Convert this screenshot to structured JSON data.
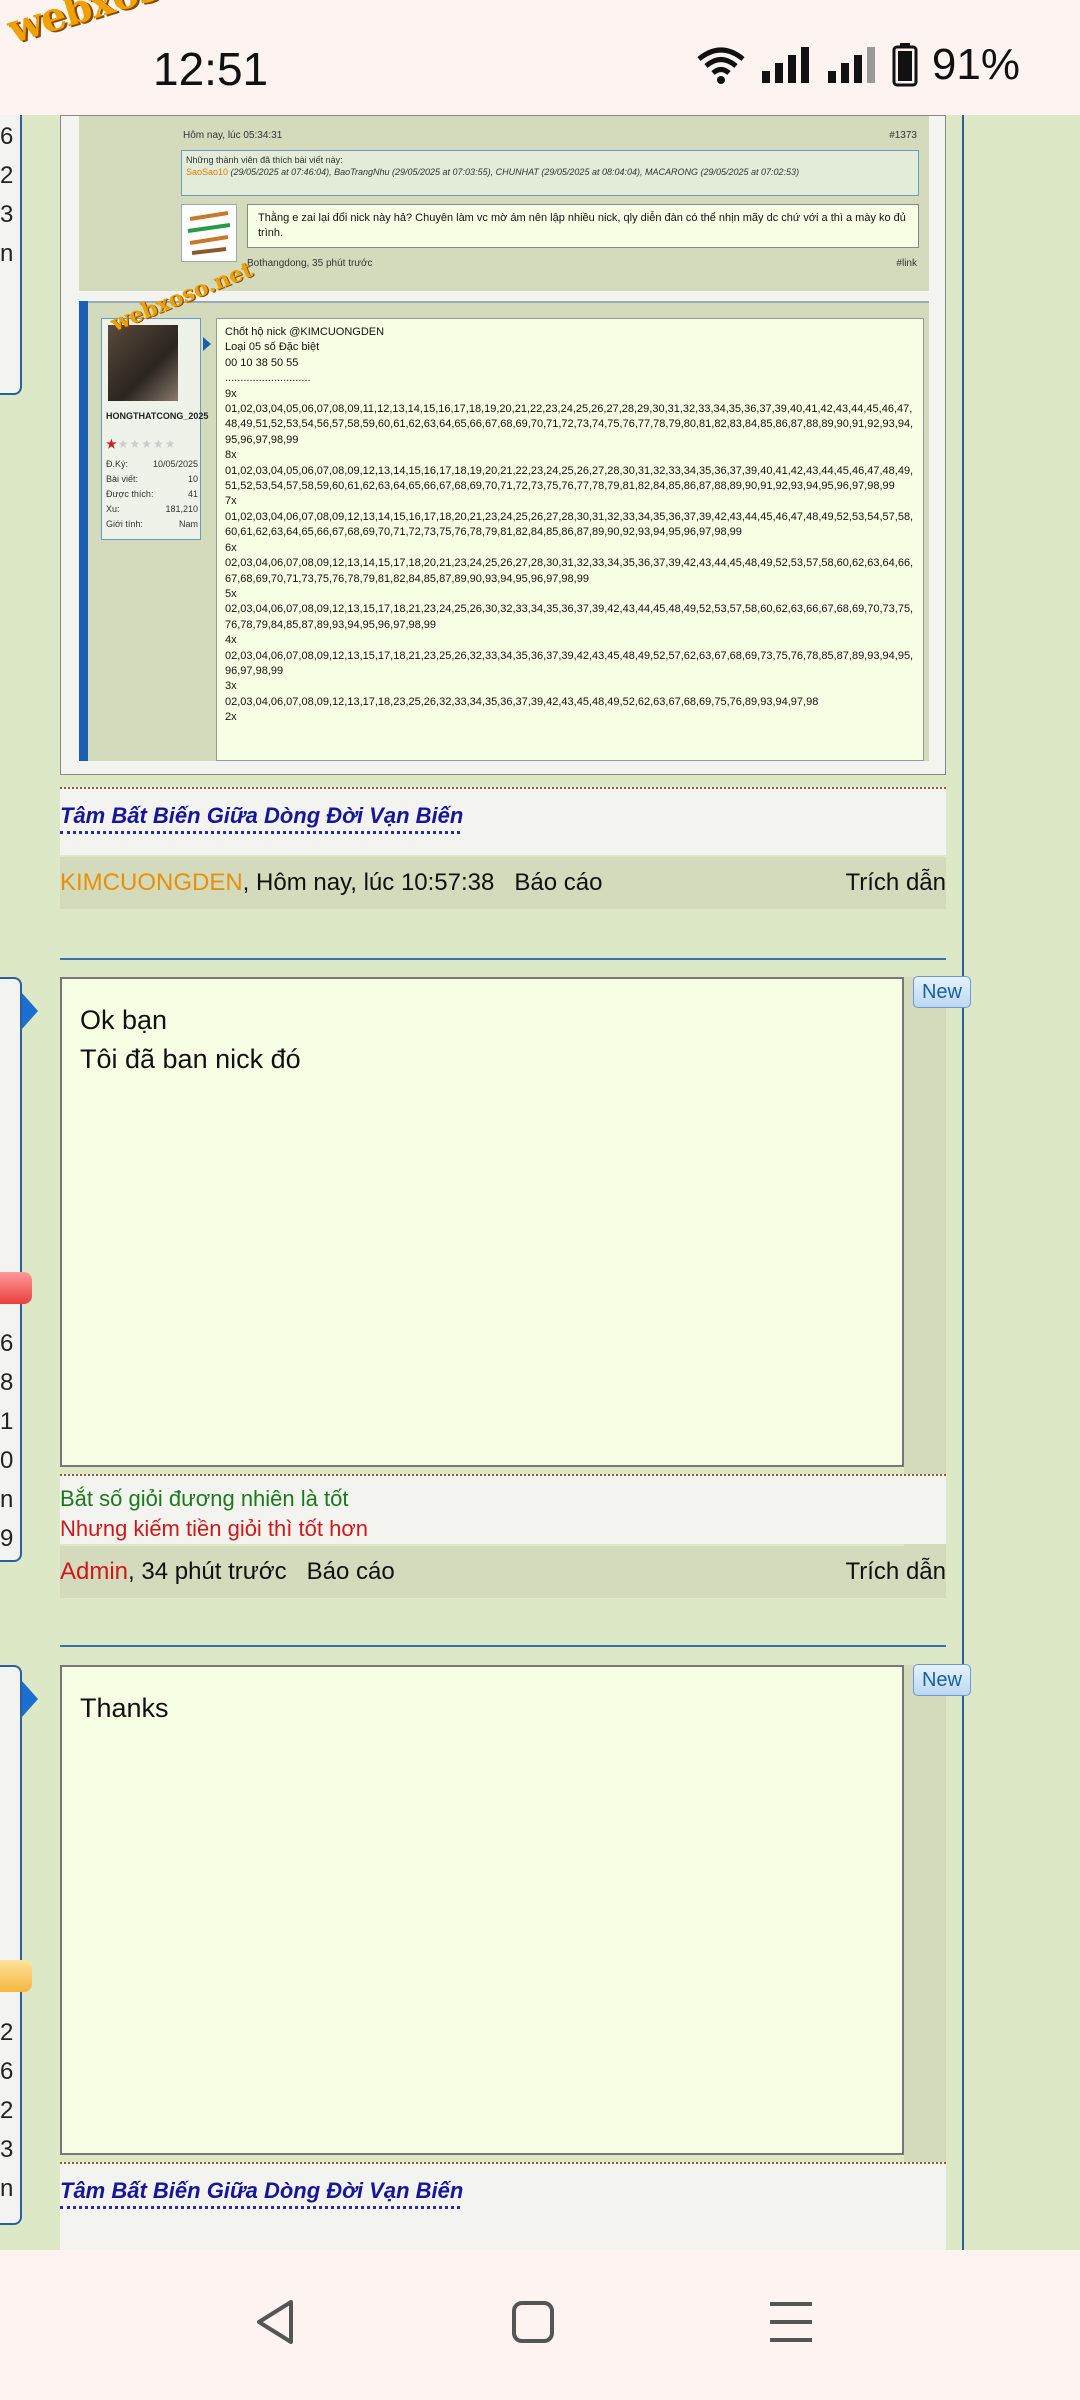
{
  "status_bar": {
    "watermark": "webxoso.net",
    "time": "12:51",
    "battery": "91%"
  },
  "left_numbers_top": [
    "6",
    "2",
    "3",
    "n"
  ],
  "left_numbers_mid": [
    "6",
    "8",
    "1",
    "0",
    "n",
    "9"
  ],
  "left_numbers_bottom": [
    "2",
    "6",
    "2",
    "3",
    "n"
  ],
  "quoted_thread": {
    "top_meta": "Hôm nay, lúc 05:34:31",
    "top_meta_id": "#1373",
    "likes_header": "Những thành viên đã thích bài viết này:",
    "likes_first_name": "SaoSao10",
    "likes_rest": " (29/05/2025 at 07:46:04), BaoTrangNhu (29/05/2025 at 07:03:55), CHUNHAT (29/05/2025 at 08:04:04), MACARONG (29/05/2025 at 07:02:53)",
    "sub_message": "Thằng e zai lại đổi nick này hả? Chuyên làm vc mờ ám nên lập nhiều nick, qly diễn đàn có thể nhịn mãy dc chứ với a thì a mày ko đủ trình.",
    "sub_footer": "Bothangdong, 35 phút trước",
    "sub_footer_link": "#link",
    "user_card": {
      "watermark": "webxoso.net",
      "username": "HONGTHATCONG_2025",
      "rows": [
        {
          "label": "Đ.Ký:",
          "value": "10/05/2025"
        },
        {
          "label": "Bài viết:",
          "value": "10"
        },
        {
          "label": "Được thích:",
          "value": "41"
        },
        {
          "label": "Xu:",
          "value": "181,210"
        },
        {
          "label": "Giới tính:",
          "value": "Nam"
        }
      ]
    },
    "message_lines": [
      "Chốt hộ nick @KIMCUONGDEN",
      "Loại 05 số Đặc biệt",
      "00 10 38 50 55",
      "............................",
      "9x",
      "01,02,03,04,05,06,07,08,09,11,12,13,14,15,16,17,18,19,20,21,22,23,24,25,26,27,28,29,30,31,32,33,34,35,36,37,39,40,41,42,43,44,45,46,47,48,49,51,52,53,54,56,57,58,59,60,61,62,63,64,65,66,67,68,69,70,71,72,73,74,75,76,77,78,79,80,81,82,83,84,85,86,87,88,89,90,91,92,93,94,95,96,97,98,99",
      "8x",
      "01,02,03,04,05,06,07,08,09,12,13,14,15,16,17,18,19,20,21,22,23,24,25,26,27,28,30,31,32,33,34,35,36,37,39,40,41,42,43,44,45,46,47,48,49,51,52,53,54,57,58,59,60,61,62,63,64,65,66,67,68,69,70,71,72,73,75,76,77,78,79,81,82,84,85,86,87,88,89,90,91,92,93,94,95,96,97,98,99",
      "7x",
      "01,02,03,04,06,07,08,09,12,13,14,15,16,17,18,20,21,23,24,25,26,27,28,30,31,32,33,34,35,36,37,39,42,43,44,45,46,47,48,49,52,53,54,57,58,60,61,62,63,64,65,66,67,68,69,70,71,72,73,75,76,78,79,81,82,84,85,86,87,89,90,92,93,94,95,96,97,98,99",
      "6x",
      "02,03,04,06,07,08,09,12,13,14,15,17,18,20,21,23,24,25,26,27,28,30,31,32,33,34,35,36,37,39,42,43,44,45,48,49,52,53,57,58,60,62,63,64,66,67,68,69,70,71,73,75,76,78,79,81,82,84,85,87,89,90,93,94,95,96,97,98,99",
      "5x",
      "02,03,04,06,07,08,09,12,13,15,17,18,21,23,24,25,26,30,32,33,34,35,36,37,39,42,43,44,45,48,49,52,53,57,58,60,62,63,66,67,68,69,70,73,75,76,78,79,84,85,87,89,93,94,95,96,97,98,99",
      "4x",
      "02,03,04,06,07,08,09,12,13,15,17,18,21,23,25,26,32,33,34,35,36,37,39,42,43,45,48,49,52,57,62,63,67,68,69,73,75,76,78,85,87,89,93,94,95,96,97,98,99",
      "3x",
      "02,03,04,06,07,08,09,12,13,17,18,23,25,26,32,33,34,35,36,37,39,42,43,45,48,49,52,62,63,67,68,69,75,76,89,93,94,97,98",
      "2x"
    ],
    "signature": "Tâm Bất Biến Giữa Dòng Đời Vạn Biến",
    "footer_user": "KIMCUONGDEN",
    "footer_time": ", Hôm nay, lúc 10:57:38",
    "footer_report": "Báo cáo",
    "footer_quote": "Trích dẫn"
  },
  "post_admin": {
    "badge": "New",
    "line1": "Ok bạn",
    "line2": "Tôi đã ban nick đó",
    "sig_line1": "Bắt số giỏi đương nhiên là tốt",
    "sig_line2": "Nhưng kiếm tiền giỏi thì tốt hơn",
    "footer_user": "Admin",
    "footer_time": ", 34 phút trước",
    "footer_report": "Báo cáo",
    "footer_quote": "Trích dẫn",
    "colors": {
      "user": "#d01818"
    }
  },
  "post_thanks": {
    "badge": "New",
    "text": "Thanks",
    "signature": "Tâm Bất Biến Giữa Dòng Đời Vạn Biến"
  },
  "nav": {
    "back": "back-icon",
    "home": "home-icon",
    "recents": "menu-icon"
  }
}
